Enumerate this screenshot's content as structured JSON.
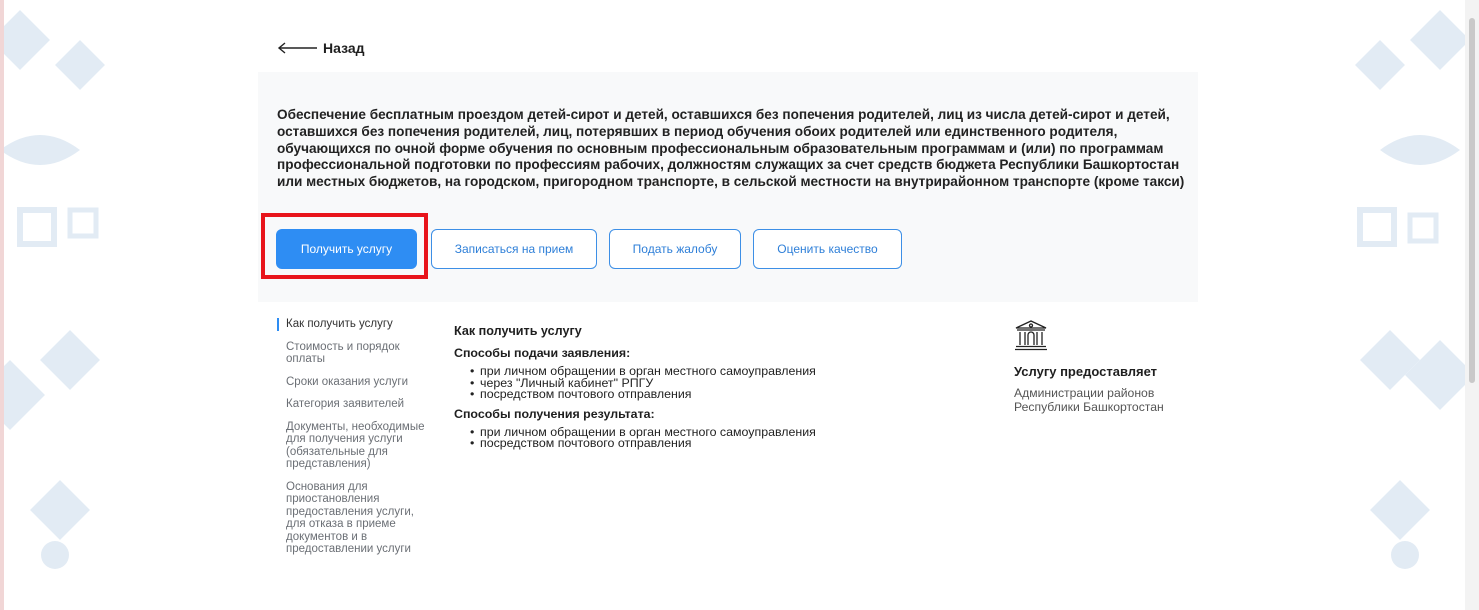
{
  "back": {
    "label": "Назад"
  },
  "service": {
    "title": "Обеспечение бесплатным проездом детей-сирот и детей, оставшихся без попечения родителей, лиц из числа детей-сирот и детей, оставшихся без попечения родителей, лиц, потерявших в период обучения обоих родителей или единственного родителя, обучающихся по очной форме обучения по основным профессиональным образовательным программам и (или) по программам профессиональной подготовки по профессиям рабочих, должностям служащих за счет средств бюджета Республики Башкортостан или местных бюджетов, на городском, пригородном транспорте, в сельской местности на внутрирайонном транспорте (кроме такси)"
  },
  "actions": {
    "get_service": "Получить услугу",
    "appointment": "Записаться на прием",
    "complaint": "Подать жалобу",
    "rate": "Оценить качество"
  },
  "sidebar": {
    "items": [
      {
        "label": "Как получить услугу",
        "active": true
      },
      {
        "label": "Стоимость и порядок оплаты"
      },
      {
        "label": "Сроки оказания услуги"
      },
      {
        "label": "Категория заявителей"
      },
      {
        "label": "Документы, необходимые для получения услуги (обязательные для представления)"
      },
      {
        "label": "Основания для приостановления предоставления услуги, для отказа в приеме документов и в предоставлении услуги"
      }
    ]
  },
  "content": {
    "heading": "Как получить услугу",
    "submit_heading": "Способы подачи заявления:",
    "submit_methods": [
      "при личном обращении в орган местного самоуправления",
      "через \"Личный кабинет\" РПГУ",
      "посредством почтового отправления"
    ],
    "result_heading": "Способы получения результата:",
    "result_methods": [
      "при личном обращении в орган местного самоуправления",
      "посредством почтового отправления"
    ]
  },
  "provider": {
    "icon": "government-building-icon",
    "title": "Услугу предоставляет",
    "org": "Администрации районов Республики Башкортостан"
  },
  "colors": {
    "primary": "#2e8df3",
    "highlight": "#e8141b",
    "ornament": "#dfe9f3"
  }
}
